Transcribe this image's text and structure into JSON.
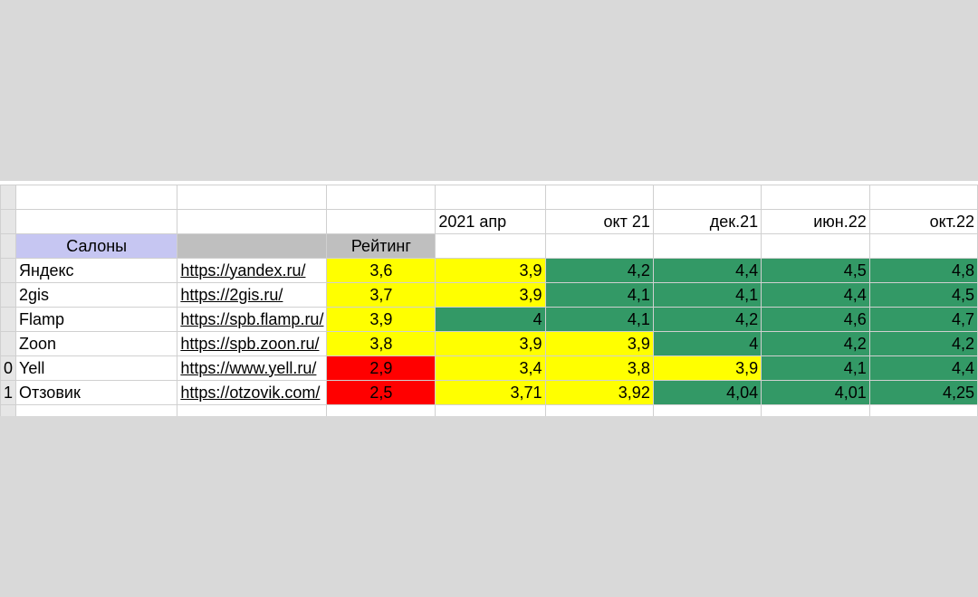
{
  "headers": {
    "salons": "Салоны",
    "rating": "Рейтинг",
    "periods": [
      "2021 апр",
      "окт 21",
      "дек.21",
      "июн.22",
      "окт.22"
    ]
  },
  "row_numbers": [
    "0",
    "1"
  ],
  "rows": [
    {
      "name": "Яндекс",
      "link": "https://yandex.ru/",
      "rating": "3,6",
      "rating_color": "yellow",
      "values": [
        "3,9",
        "4,2",
        "4,4",
        "4,5",
        "4,8"
      ],
      "colors": [
        "yellow",
        "green",
        "green",
        "green",
        "green"
      ]
    },
    {
      "name": "2gis",
      "link": "https://2gis.ru/",
      "rating": "3,7",
      "rating_color": "yellow",
      "values": [
        "3,9",
        "4,1",
        "4,1",
        "4,4",
        "4,5"
      ],
      "colors": [
        "yellow",
        "green",
        "green",
        "green",
        "green"
      ]
    },
    {
      "name": "Flamp",
      "link": "https://spb.flamp.ru/",
      "rating": "3,9",
      "rating_color": "yellow",
      "values": [
        "4",
        "4,1",
        "4,2",
        "4,6",
        "4,7"
      ],
      "colors": [
        "green",
        "green",
        "green",
        "green",
        "green"
      ]
    },
    {
      "name": "Zoon",
      "link": "https://spb.zoon.ru/",
      "rating": "3,8",
      "rating_color": "yellow",
      "values": [
        "3,9",
        "3,9",
        "4",
        "4,2",
        "4,2"
      ],
      "colors": [
        "yellow",
        "yellow",
        "green",
        "green",
        "green"
      ]
    },
    {
      "name": "Yell",
      "link": "https://www.yell.ru/",
      "rating": "2,9",
      "rating_color": "red",
      "values": [
        "3,4",
        "3,8",
        "3,9",
        "4,1",
        "4,4"
      ],
      "colors": [
        "yellow",
        "yellow",
        "yellow",
        "green",
        "green"
      ]
    },
    {
      "name": "Отзовик",
      "link": "https://otzovik.com/",
      "rating": "2,5",
      "rating_color": "red",
      "values": [
        "3,71",
        "3,92",
        "4,04",
        "4,01",
        "4,25"
      ],
      "colors": [
        "yellow",
        "yellow",
        "green",
        "green",
        "green"
      ]
    }
  ],
  "colors": {
    "yellow": "#ffff00",
    "green": "#339966",
    "red": "#ff0000",
    "salon_header": "#c6c6f2",
    "gray_header": "#bfbfbf",
    "link": "#1f1fd6"
  }
}
